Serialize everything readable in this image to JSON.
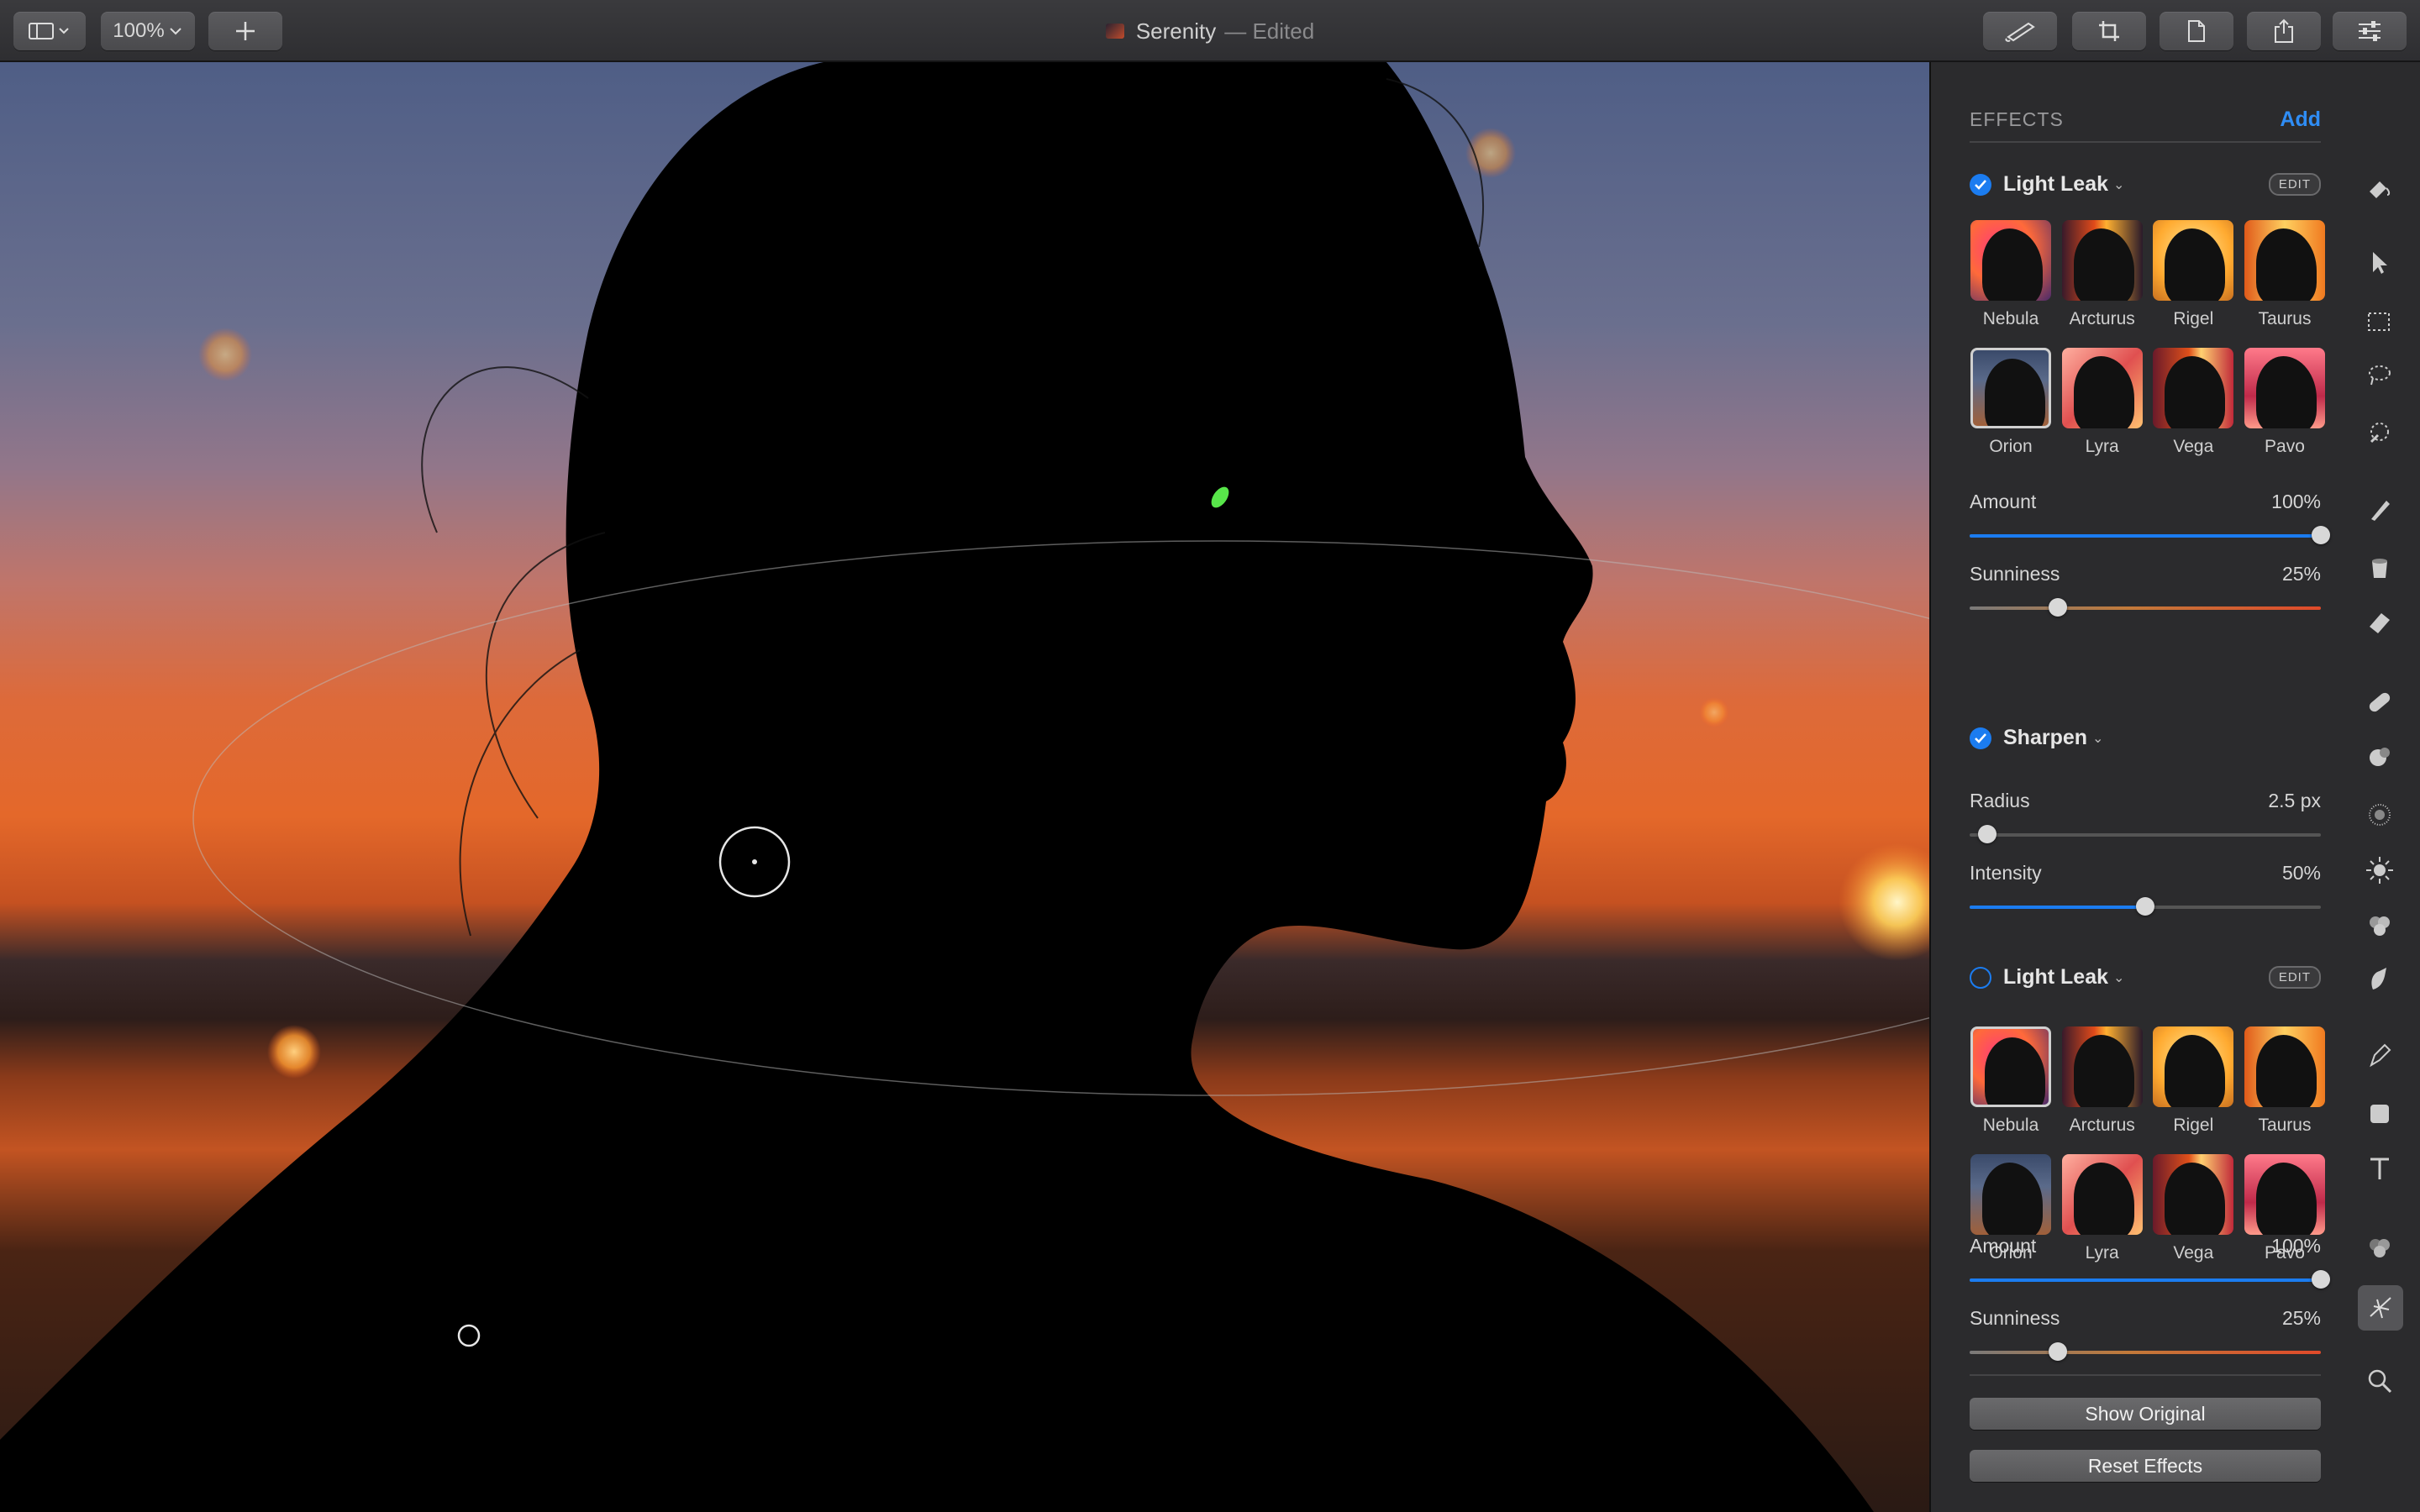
{
  "toolbar": {
    "zoom_label": "100%",
    "doc_title": "Serenity",
    "doc_status": "— Edited",
    "buttons": [
      "sidebar-toggle",
      "zoom",
      "add",
      "brush",
      "crop",
      "document",
      "share",
      "adjust"
    ]
  },
  "effects": {
    "header": "EFFECTS",
    "add_label": "Add",
    "blocks": [
      {
        "name": "Light Leak",
        "enabled": true,
        "edit_label": "EDIT",
        "presets": [
          "Nebula",
          "Arcturus",
          "Rigel",
          "Taurus",
          "Orion",
          "Lyra",
          "Vega",
          "Pavo"
        ],
        "selected": "Orion",
        "sliders": [
          {
            "label": "Amount",
            "value": "100%",
            "level": 1.0,
            "kind": "blue"
          },
          {
            "label": "Sunniness",
            "value": "25%",
            "level": 0.25,
            "kind": "warm"
          }
        ]
      },
      {
        "name": "Sharpen",
        "enabled": true,
        "sliders": [
          {
            "label": "Radius",
            "value": "2.5 px",
            "level": 0.05,
            "kind": "plain"
          },
          {
            "label": "Intensity",
            "value": "50%",
            "level": 0.5,
            "kind": "blue"
          }
        ]
      },
      {
        "name": "Light Leak",
        "enabled": false,
        "edit_label": "EDIT",
        "presets": [
          "Nebula",
          "Arcturus",
          "Rigel",
          "Taurus",
          "Orion",
          "Lyra",
          "Vega",
          "Pavo"
        ],
        "selected": "Nebula",
        "sliders": [
          {
            "label": "Amount",
            "value": "100%",
            "level": 1.0,
            "kind": "blue"
          },
          {
            "label": "Sunniness",
            "value": "25%",
            "level": 0.25,
            "kind": "warm"
          }
        ]
      }
    ],
    "show_original_label": "Show Original",
    "reset_label": "Reset Effects"
  },
  "tools": [
    "paint-bucket-icon",
    "arrow-pointer-icon",
    "rect-select-icon",
    "lasso-icon",
    "magic-select-icon",
    "brush-icon",
    "bucket-icon",
    "eraser-icon",
    "bandage-icon",
    "clone-icon",
    "noise-icon",
    "sun-icon",
    "color-icon",
    "smudge-icon",
    "pen-icon",
    "shape-icon",
    "text-icon",
    "layers-icon",
    "effects-icon",
    "zoom-icon"
  ],
  "colors": {
    "accent": "#1b7cf0",
    "panel": "#2b2b2d",
    "toolbar": "#333336"
  }
}
